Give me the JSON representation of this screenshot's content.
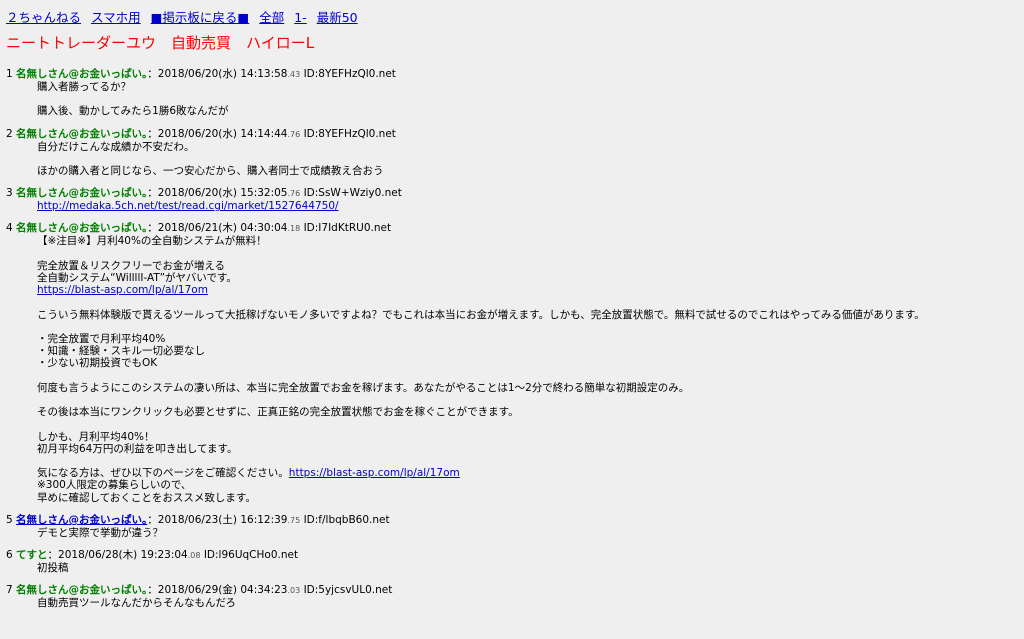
{
  "nav": {
    "links": [
      "２ちゃんねる",
      "スマホ用",
      "■掲示板に戻る■",
      "全部",
      "1-",
      "最新50"
    ]
  },
  "thread_title": "ニートトレーダーユウ　自動売買　ハイローL",
  "colors": {
    "title": "#ff0000",
    "name": "#008000",
    "link": "#0000cc",
    "background": "#efefef"
  },
  "posts": [
    {
      "num": "1",
      "name": "名無しさん@お金いっぱい。",
      "date": "：2018/06/20(水) 14:13:58",
      "ms": ".43",
      "id": " ID:8YEFHzQl0.net",
      "lines": [
        "購入者勝ってるか？",
        "",
        "購入後、動かしてみたら1勝6敗なんだが"
      ]
    },
    {
      "num": "2",
      "name": "名無しさん@お金いっぱい。",
      "date": "：2018/06/20(水) 14:14:44",
      "ms": ".76",
      "id": " ID:8YEFHzQl0.net",
      "lines": [
        "自分だけこんな成績か不安だわ。",
        "",
        "ほかの購入者と同じなら、一つ安心だから、購入者同士で成績教え合おう"
      ]
    },
    {
      "num": "3",
      "name": "名無しさん@お金いっぱい。",
      "date": "：2018/06/20(水) 15:32:05",
      "ms": ".76",
      "id": " ID:SsW+Wziy0.net",
      "link": "http://medaka.5ch.net/test/read.cgi/market/1527644750/"
    },
    {
      "num": "4",
      "name": "名無しさん@お金いっぱい。",
      "date": "：2018/06/21(木) 04:30:04",
      "ms": ".18",
      "id": " ID:I7IdKtRU0.net",
      "p1": "【※注目※】月利40%の全自動システムが無料！\n\n完全放置＆リスクフリーでお金が増える\n全自動システム“WillllI-AT”がヤバいです。",
      "link1": "https://blast-asp.com/lp/al/17om",
      "p2": "こういう無料体験版で貰えるツールって大抵稼げないモノ多いですよね？でもこれは本当にお金が増えます。しかも、完全放置状態で。無料で試せるのでこれはやってみる価値があります。\n\n・完全放置で月利平均40%\n・知識・経験・スキル一切必要なし\n・少ない初期投資でもOK\n\n何度も言うようにこのシステムの凄い所は、本当に完全放置でお金を稼げます。あなたがやることは1〜2分で終わる簡単な初期設定のみ。\n\nその後は本当にワンクリックも必要とせずに、正真正銘の完全放置状態でお金を稼ぐことができます。\n\nしかも、月利平均40%！\n初月平均64万円の利益を叩き出してます。\n",
      "p3_prefix": "気になる方は、ぜひ以下のページをご確認ください。",
      "link2": "https://blast-asp.com/lp/al/17om",
      "p4": "※300人限定の募集らしいので、\n早めに確認しておくことをおススメ致します。"
    },
    {
      "num": "5",
      "name": "名無しさん@お金いっぱい。",
      "date": "：2018/06/23(土) 16:12:39",
      "ms": ".75",
      "id": " ID:f/lbqbB60.net",
      "lines": [
        "デモと実際で挙動が違う？"
      ]
    },
    {
      "num": "6",
      "name": "てすと",
      "date": "：2018/06/28(木) 19:23:04",
      "ms": ".08",
      "id": " ID:l96UqCHo0.net",
      "lines": [
        "初投稿"
      ]
    },
    {
      "num": "7",
      "name": "名無しさん@お金いっぱい。",
      "date": "：2018/06/29(金) 04:34:23",
      "ms": ".03",
      "id": " ID:5yjcsvUL0.net",
      "lines": [
        "自動売買ツールなんだからそんなもんだろ"
      ]
    }
  ]
}
